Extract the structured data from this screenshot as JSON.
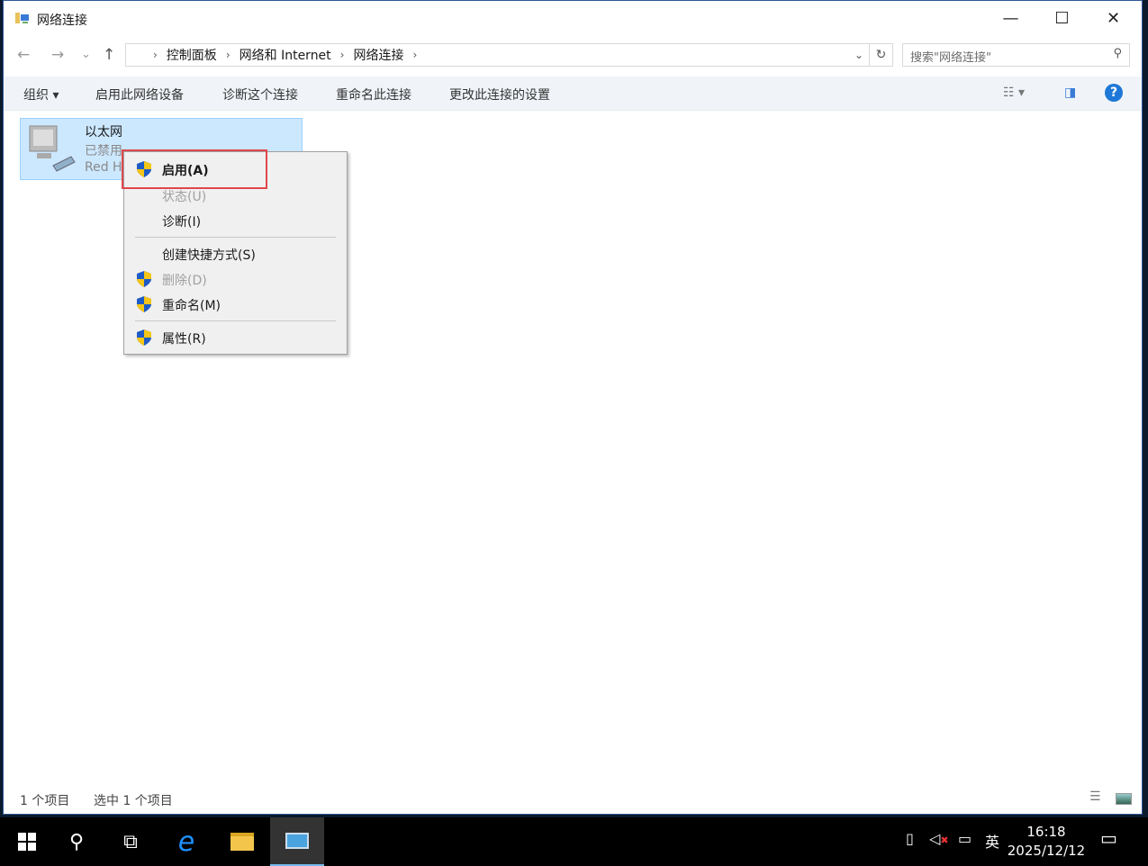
{
  "window": {
    "title": "网络连接",
    "minimize": "—",
    "maximize": "☐",
    "close": "✕"
  },
  "nav": {
    "back": "←",
    "forward": "→",
    "recent": "⌄",
    "up": "↑",
    "breadcrumb": [
      "控制面板",
      "网络和 Internet",
      "网络连接"
    ],
    "refresh": "↻",
    "search_placeholder": "搜索\"网络连接\""
  },
  "toolbar": {
    "organize": "组织 ▾",
    "enable": "启用此网络设备",
    "diagnose": "诊断这个连接",
    "rename": "重命名此连接",
    "change": "更改此连接的设置"
  },
  "connection": {
    "name": "以太网",
    "status": "已禁用",
    "device": "Red H"
  },
  "context_menu": [
    {
      "label": "启用(A)",
      "shield": true,
      "disabled": false,
      "bold": true
    },
    {
      "label": "状态(U)",
      "shield": false,
      "disabled": true
    },
    {
      "label": "诊断(I)",
      "shield": false,
      "disabled": false
    },
    {
      "label": "创建快捷方式(S)",
      "shield": false,
      "disabled": false
    },
    {
      "label": "删除(D)",
      "shield": true,
      "disabled": true
    },
    {
      "label": "重命名(M)",
      "shield": true,
      "disabled": false
    },
    {
      "label": "属性(R)",
      "shield": true,
      "disabled": false
    }
  ],
  "statusbar": {
    "count": "1 个项目",
    "selected": "选中 1 个项目"
  },
  "taskbar": {
    "time": "16:18",
    "date": "2025/12/12",
    "ime": "英"
  },
  "colors": {
    "selection": "#cce8ff",
    "highlight_box": "#e0474c",
    "accent": "#1e78d7"
  }
}
